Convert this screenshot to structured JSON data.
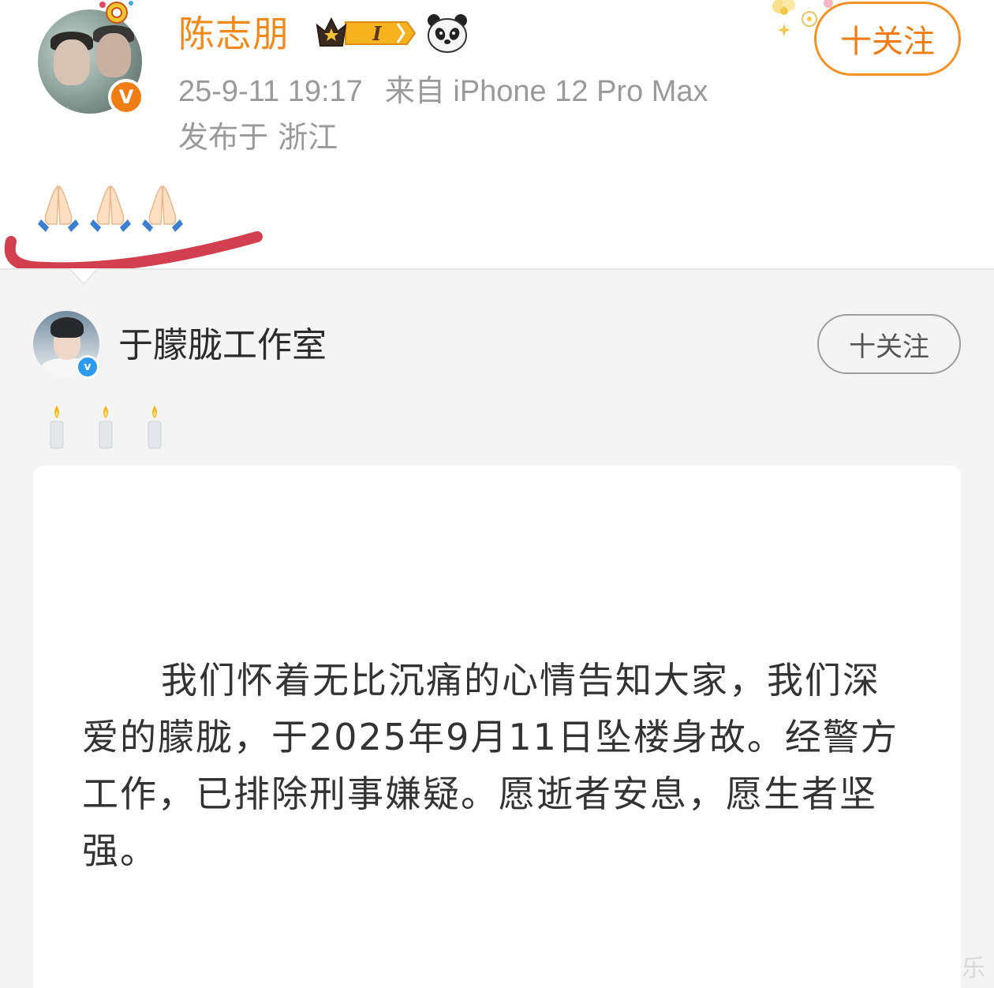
{
  "original_post": {
    "author_name": "陈志朋",
    "vip_level": "I",
    "verified_mark": "V",
    "timestamp": "25-9-11 19:17",
    "source": "来自 iPhone 12 Pro Max",
    "location": "发布于 浙江",
    "follow_label": "+关注",
    "follow_label_display": "十关注",
    "emoji": [
      "folded-hands",
      "folded-hands",
      "folded-hands"
    ],
    "annotation_color": "#d2404f",
    "accent_color": "#f07c14"
  },
  "repost": {
    "author_name": "于朦胧工作室",
    "verified_mark": "v",
    "follow_label_display": "十关注",
    "emoji": [
      "candle",
      "candle",
      "candle"
    ],
    "statement": "我们怀着无比沉痛的心情告知大家，我们深爱的朦胧，于2025年9月11日坠楼身故。经警方工作，已排除刑事嫌疑。愿逝者安息，愿生者坚强。",
    "verify_color": "#2d9bf0"
  },
  "watermark_char": "乐"
}
